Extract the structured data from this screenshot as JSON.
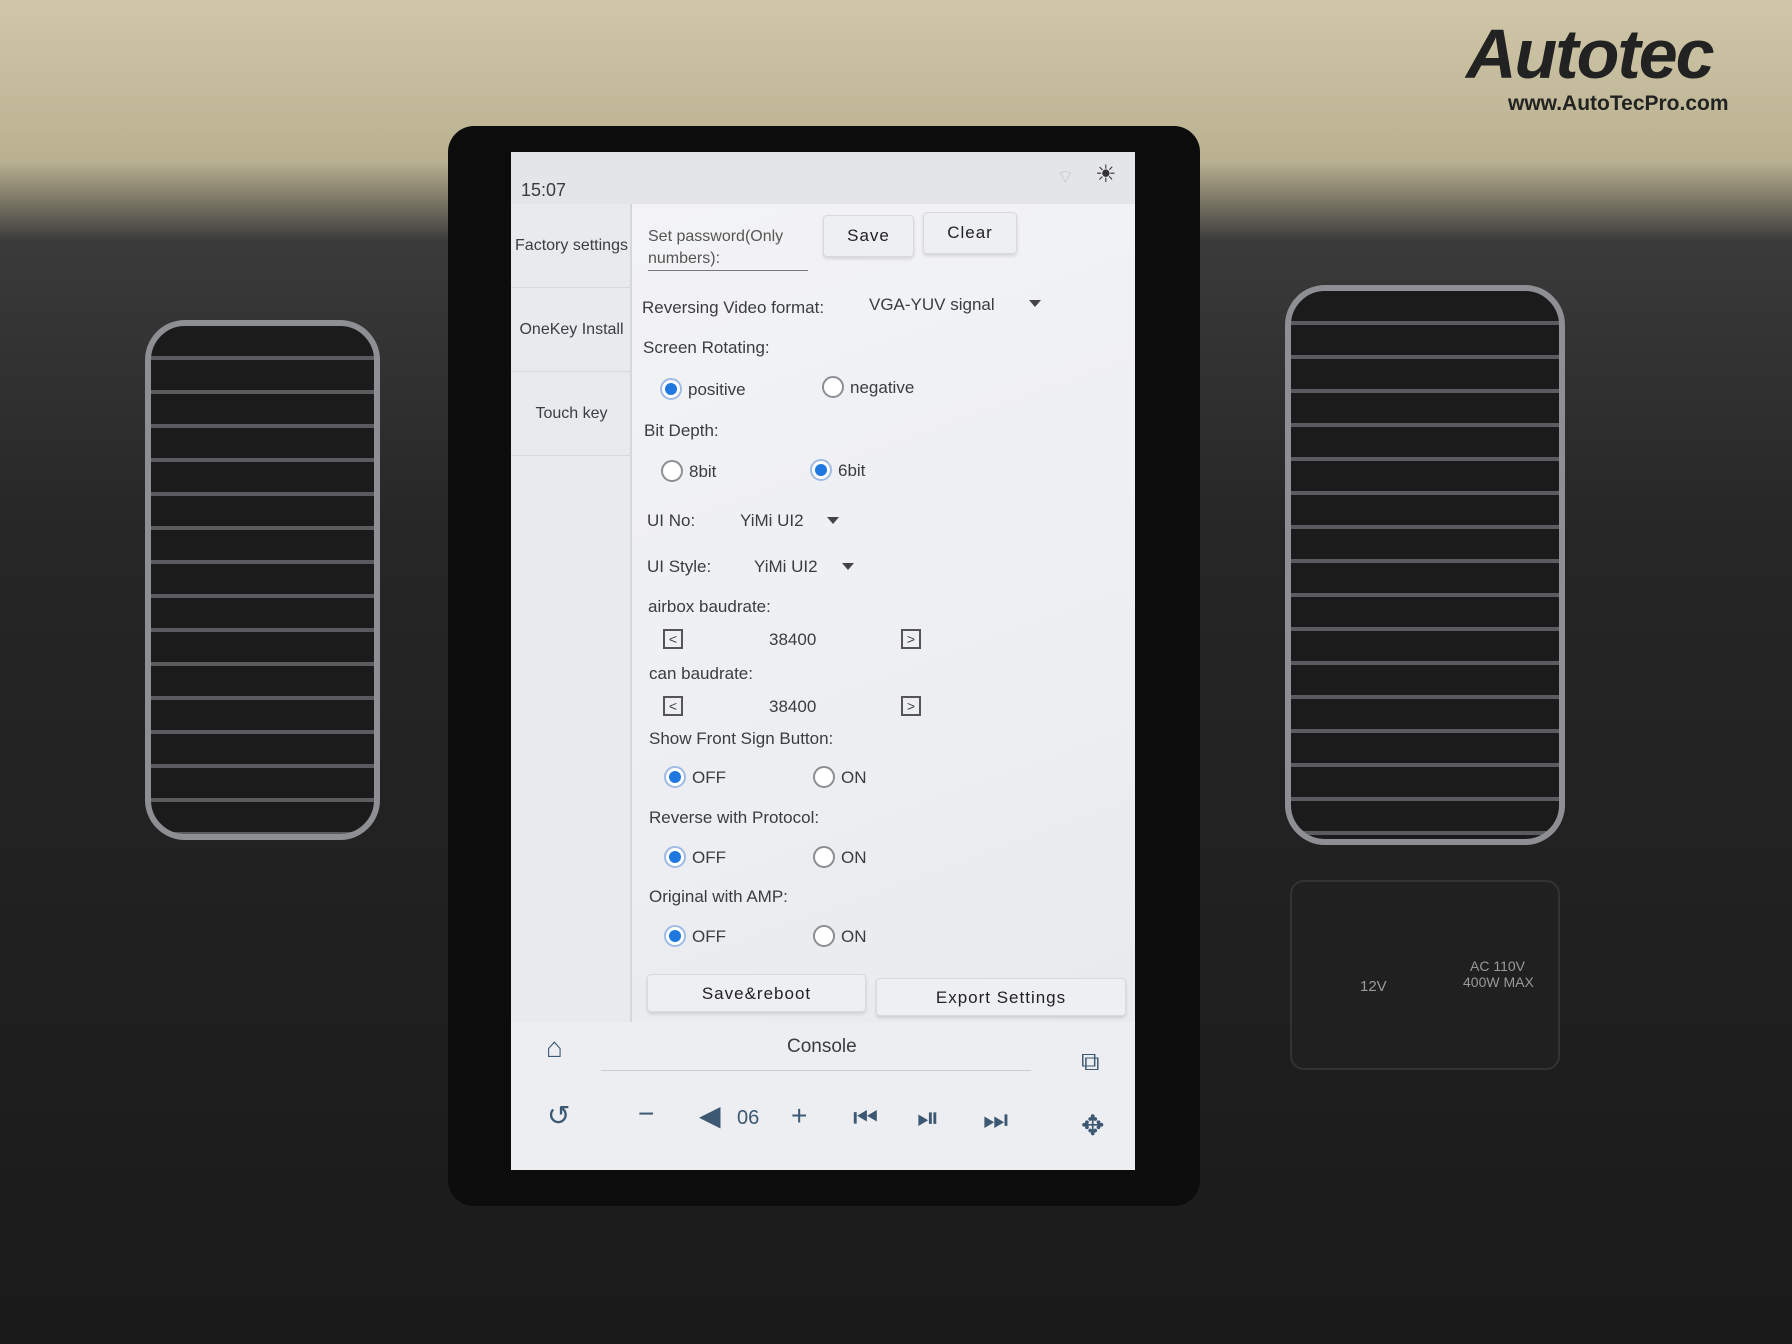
{
  "brand": {
    "logo": "Autotec",
    "url": "www.AutoTecPro.com"
  },
  "status": {
    "time": "15:07",
    "icons": [
      "wifi-icon",
      "brightness-icon"
    ]
  },
  "sidebar": {
    "items": [
      {
        "label": "Factory settings"
      },
      {
        "label": "OneKey Install"
      },
      {
        "label": "Touch key"
      }
    ]
  },
  "settings": {
    "password": {
      "label": "Set password(Only numbers):",
      "label_l1": "Set password(Only",
      "label_l2": "numbers):",
      "save": "Save",
      "clear": "Clear"
    },
    "reversing_video": {
      "label": "Reversing Video format:",
      "value": "VGA-YUV signal"
    },
    "screen_rotating": {
      "label": "Screen Rotating:",
      "options": [
        "positive",
        "negative"
      ],
      "selected": "positive"
    },
    "bit_depth": {
      "label": "Bit Depth:",
      "options": [
        "8bit",
        "6bit"
      ],
      "selected": "6bit"
    },
    "ui_no": {
      "label": "UI No:",
      "value": "YiMi UI2"
    },
    "ui_style": {
      "label": "UI Style:",
      "value": "YiMi UI2"
    },
    "airbox_baudrate": {
      "label": "airbox baudrate:",
      "value": "38400"
    },
    "can_baudrate": {
      "label": "can baudrate:",
      "value": "38400"
    },
    "show_front_sign": {
      "label": "Show Front Sign Button:",
      "options": [
        "OFF",
        "ON"
      ],
      "selected": "OFF"
    },
    "reverse_protocol": {
      "label": "Reverse with Protocol:",
      "options": [
        "OFF",
        "ON"
      ],
      "selected": "OFF"
    },
    "original_amp": {
      "label": "Original with AMP:",
      "options": [
        "OFF",
        "ON"
      ],
      "selected": "OFF"
    },
    "save_reboot": "Save&reboot",
    "export": "Export Settings"
  },
  "console": {
    "title": "Console",
    "volume": "06"
  },
  "dash": {
    "outlet_12v": "12V",
    "outlet_ac": "AC 110V",
    "outlet_ac2": "400W MAX"
  },
  "colors": {
    "accent": "#1e78e0",
    "icon": "#3d5872",
    "logo_red": "#d0182a"
  }
}
